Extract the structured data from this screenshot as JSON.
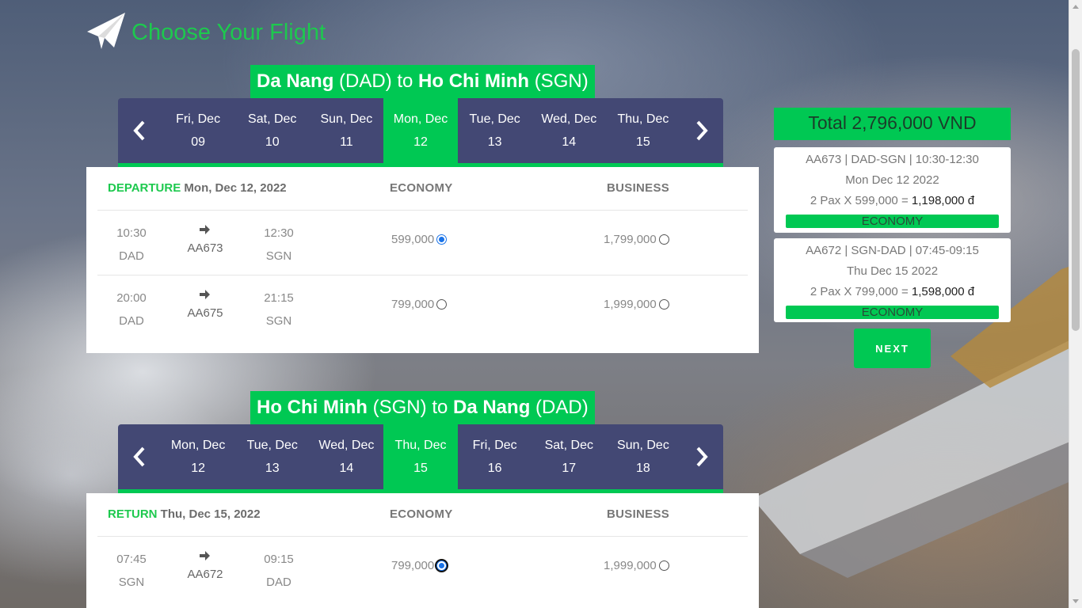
{
  "header": {
    "title": "Choose Your Flight",
    "icon": "paper-plane-icon"
  },
  "outbound": {
    "route": {
      "from_city": "Da Nang",
      "from_code": "(DAD)",
      "to_word": "to",
      "to_city": "Ho Chi Minh",
      "to_code": "(SGN)"
    },
    "dates": [
      {
        "day": "Fri, Dec",
        "num": "09",
        "active": false
      },
      {
        "day": "Sat, Dec",
        "num": "10",
        "active": false
      },
      {
        "day": "Sun, Dec",
        "num": "11",
        "active": false
      },
      {
        "day": "Mon, Dec",
        "num": "12",
        "active": true
      },
      {
        "day": "Tue, Dec",
        "num": "13",
        "active": false
      },
      {
        "day": "Wed, Dec",
        "num": "14",
        "active": false
      },
      {
        "day": "Thu, Dec",
        "num": "15",
        "active": false
      }
    ],
    "label_kind": "DEPARTURE",
    "label_date": "Mon, Dec 12, 2022",
    "col_economy": "ECONOMY",
    "col_business": "BUSINESS",
    "flights": [
      {
        "dep_time": "10:30",
        "dep_code": "DAD",
        "flight_no": "AA673",
        "arr_time": "12:30",
        "arr_code": "SGN",
        "economy": "599,000",
        "business": "1,799,000",
        "selected": "economy"
      },
      {
        "dep_time": "20:00",
        "dep_code": "DAD",
        "flight_no": "AA675",
        "arr_time": "21:15",
        "arr_code": "SGN",
        "economy": "799,000",
        "business": "1,999,000",
        "selected": ""
      }
    ]
  },
  "return": {
    "route": {
      "from_city": "Ho Chi Minh",
      "from_code": "(SGN)",
      "to_word": "to",
      "to_city": "Da Nang",
      "to_code": "(DAD)"
    },
    "dates": [
      {
        "day": "Mon, Dec",
        "num": "12",
        "active": false
      },
      {
        "day": "Tue, Dec",
        "num": "13",
        "active": false
      },
      {
        "day": "Wed, Dec",
        "num": "14",
        "active": false
      },
      {
        "day": "Thu, Dec",
        "num": "15",
        "active": true
      },
      {
        "day": "Fri, Dec",
        "num": "16",
        "active": false
      },
      {
        "day": "Sat, Dec",
        "num": "17",
        "active": false
      },
      {
        "day": "Sun, Dec",
        "num": "18",
        "active": false
      }
    ],
    "label_kind": "RETURN",
    "label_date": "Thu, Dec 15, 2022",
    "col_economy": "ECONOMY",
    "col_business": "BUSINESS",
    "flights": [
      {
        "dep_time": "07:45",
        "dep_code": "SGN",
        "flight_no": "AA672",
        "arr_time": "09:15",
        "arr_code": "DAD",
        "economy": "799,000",
        "business": "1,999,000",
        "selected": "economy"
      }
    ]
  },
  "summary": {
    "total": "Total 2,796,000 VND",
    "cards": [
      {
        "line1": "AA673 | DAD-SGN | 10:30-12:30",
        "line2": "Mon Dec 12 2022",
        "calc": "2 Pax X 599,000 = ",
        "amount": "1,198,000 đ",
        "class": "ECONOMY"
      },
      {
        "line1": "AA672 | SGN-DAD | 07:45-09:15",
        "line2": "Thu Dec 15 2022",
        "calc": "2 Pax X 799,000 = ",
        "amount": "1,598,000 đ",
        "class": "ECONOMY"
      }
    ],
    "next_label": "NEXT"
  },
  "colors": {
    "accent": "#00c853",
    "strip": "#434874",
    "radio": "#1a73e8"
  }
}
